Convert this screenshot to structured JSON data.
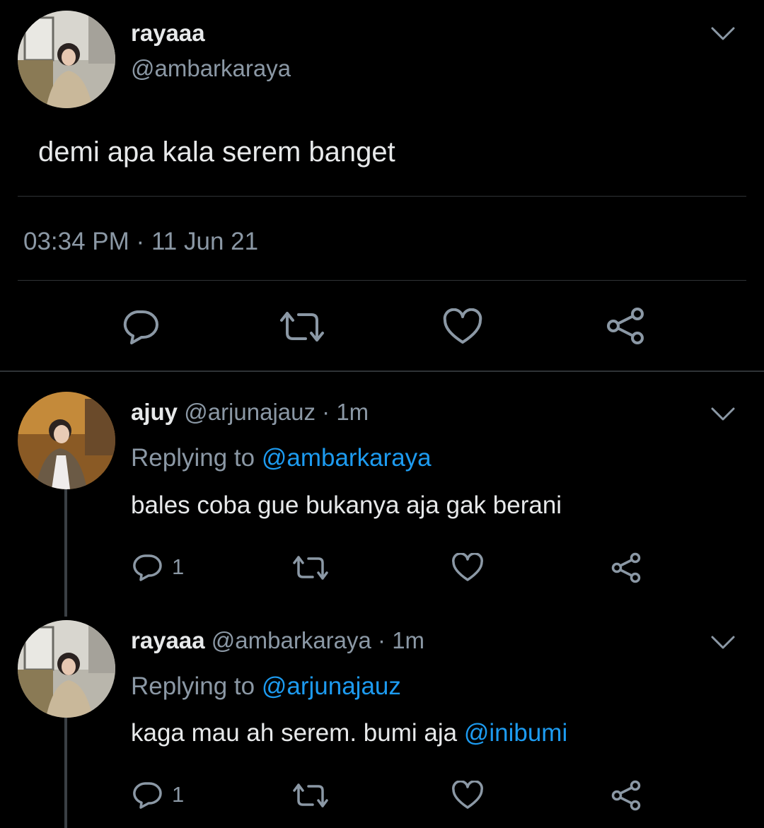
{
  "main_tweet": {
    "display_name": "rayaaa",
    "handle": "@ambarkaraya",
    "text": "demi apa kala serem banget",
    "time": "03:34 PM",
    "separator": "·",
    "date": "11 Jun 21"
  },
  "replies": [
    {
      "display_name": "ajuy",
      "handle": "@arjunajauz",
      "time": "· 1m",
      "replying_prefix": "Replying to",
      "replying_to": "@ambarkaraya",
      "text": "bales coba gue bukanya aja gak berani",
      "mention": "",
      "reply_count": "1"
    },
    {
      "display_name": "rayaaa",
      "handle": "@ambarkaraya",
      "time": "· 1m",
      "replying_prefix": "Replying to",
      "replying_to": "@arjunajauz",
      "text": "kaga mau ah serem. bumi aja",
      "mention": "@inibumi",
      "reply_count": "1"
    }
  ],
  "icons": {
    "reply": "reply-icon",
    "retweet": "retweet-icon",
    "like": "heart-icon",
    "share": "share-icon",
    "more": "chevron-down-icon"
  },
  "colors": {
    "background": "#000000",
    "link": "#1d9bf0",
    "muted": "#8b98a5",
    "icon": "#8b98a5"
  }
}
